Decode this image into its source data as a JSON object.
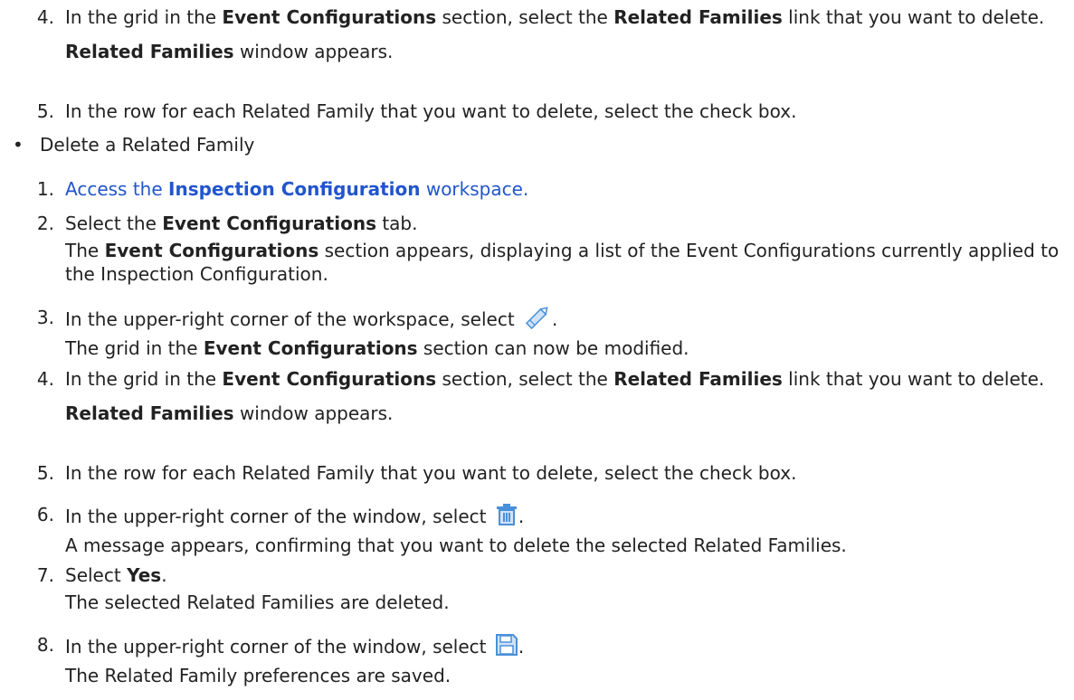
{
  "prev_steps": {
    "step4": {
      "num": "4.",
      "p1": "In the grid in the ",
      "b1": "Event Configurations",
      "p2": " section, select the ",
      "b2": "Related Families",
      "p3": " link that you want to delete.",
      "r_b": "Related Families",
      "r_text": " window appears."
    },
    "step5": {
      "num": "5.",
      "text": "In the row for each Related Family that you want to delete, select the check box."
    }
  },
  "bullet": {
    "symbol": "•",
    "label": "Delete a Related Family"
  },
  "steps": {
    "s1": {
      "num": "1.",
      "p1": "Access the ",
      "b1": "Inspection Configuration",
      "p2": " workspace."
    },
    "s2": {
      "num": "2.",
      "p1": "Select the ",
      "b1": "Event Configurations",
      "p2": " tab.",
      "r_p1": "The ",
      "r_b": "Event Configurations",
      "r_p2": " section appears, displaying a list of the Event Configurations currently applied to the Inspection Configuration."
    },
    "s3": {
      "num": "3.",
      "p1": "In the upper-right corner of the workspace, select ",
      "p2": ".",
      "icon": "pencil-icon",
      "r_p1": "The grid in the ",
      "r_b": "Event Configurations",
      "r_p2": " section can now be modified."
    },
    "s4": {
      "num": "4.",
      "p1": "In the grid in the ",
      "b1": "Event Configurations",
      "p2": " section, select the ",
      "b2": "Related Families",
      "p3": " link that you want to delete.",
      "r_b": "Related Families",
      "r_text": " window appears."
    },
    "s5": {
      "num": "5.",
      "text": "In the row for each Related Family that you want to delete, select the check box."
    },
    "s6": {
      "num": "6.",
      "p1": "In the upper-right corner of the window, select ",
      "p2": ".",
      "icon": "trash-icon",
      "r_text": "A message appears, confirming that you want to delete the selected Related Families."
    },
    "s7": {
      "num": "7.",
      "p1": "Select ",
      "b1": "Yes",
      "p2": ".",
      "r_text": "The selected Related Families are deleted."
    },
    "s8": {
      "num": "8.",
      "p1": "In the upper-right corner of the window, select ",
      "p2": ".",
      "icon": "save-icon",
      "r_text": "The Related Family preferences are saved."
    }
  },
  "colors": {
    "text": "#222222",
    "link": "#2255cc",
    "icon_blue": "#4a90d9"
  }
}
